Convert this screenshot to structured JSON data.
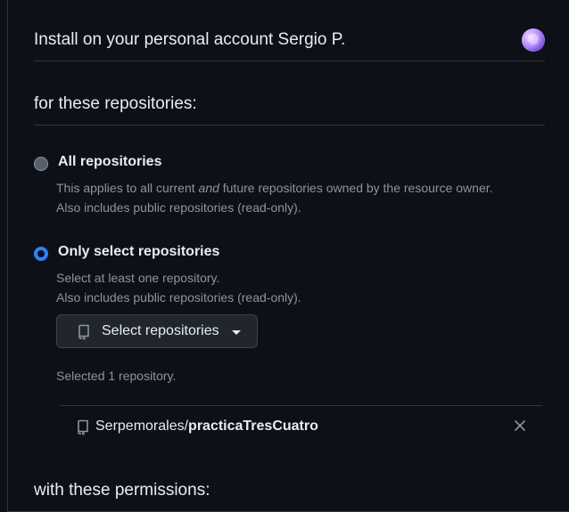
{
  "header": {
    "title": "Install on your personal account Sergio P."
  },
  "repositories_section": {
    "title": "for these repositories:"
  },
  "options": {
    "all": {
      "label": "All repositories",
      "desc_pre": "This applies to all current ",
      "desc_em": "and",
      "desc_post": " future repositories owned by the resource owner.",
      "desc_line2": "Also includes public repositories (read-only).",
      "selected": false
    },
    "only": {
      "label": "Only select repositories",
      "desc_line1": "Select at least one repository.",
      "desc_line2": "Also includes public repositories (read-only).",
      "selected": true
    }
  },
  "select_button": {
    "label": "Select repositories"
  },
  "selected_count": "Selected 1 repository.",
  "selected_repo": {
    "owner": "Serpemorales/",
    "name": "practicaTresCuatro"
  },
  "permissions_section": {
    "title": "with these permissions:"
  },
  "colors": {
    "accent": "#2f81f7",
    "background": "#0d1117",
    "muted_text": "#8b949e"
  }
}
